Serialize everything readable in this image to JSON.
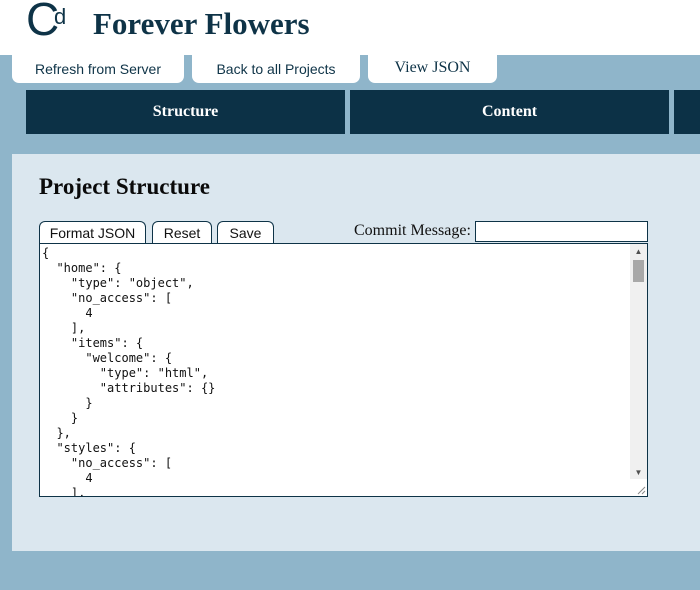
{
  "header": {
    "logo": {
      "big": "C",
      "small": "d"
    },
    "title": "Forever Flowers"
  },
  "top_tabs": {
    "refresh": "Refresh from Server",
    "back": "Back to all Projects",
    "view_json": "View JSON"
  },
  "nav": {
    "structure": "Structure",
    "content": "Content"
  },
  "panel": {
    "title": "Project Structure",
    "format_json": "Format JSON",
    "reset": "Reset",
    "save": "Save",
    "commit_label": "Commit Message:",
    "commit_value": "",
    "json_text": "{\n  \"home\": {\n    \"type\": \"object\",\n    \"no_access\": [\n      4\n    ],\n    \"items\": {\n      \"welcome\": {\n        \"type\": \"html\",\n        \"attributes\": {}\n      }\n    }\n  },\n  \"styles\": {\n    \"no_access\": [\n      4\n    ],"
  },
  "icons": {
    "scroll_up": "▲",
    "scroll_down": "▼"
  },
  "colors": {
    "page_bg": "#8fb5ca",
    "navy": "#0c3146",
    "panel_bg": "#dbe7ef"
  }
}
